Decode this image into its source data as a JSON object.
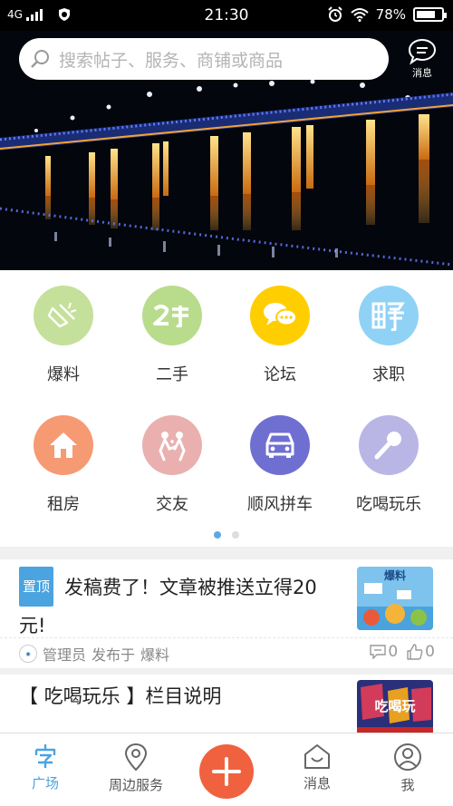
{
  "status_bar": {
    "network": "4G",
    "time": "21:30",
    "battery": "78%",
    "battery_level": 0.78
  },
  "header": {
    "search_placeholder": "搜索帖子、服务、商铺或商品",
    "message_label": "消息"
  },
  "categories": [
    {
      "label": "爆料",
      "color": "#c5e09a",
      "icon": "megaphone-icon"
    },
    {
      "label": "二手",
      "color": "#b8dc8c",
      "icon": "second-hand-icon"
    },
    {
      "label": "论坛",
      "color": "#ffce00",
      "icon": "chat-bubbles-icon"
    },
    {
      "label": "求职",
      "color": "#8fd2f5",
      "icon": "recruit-icon"
    },
    {
      "label": "租房",
      "color": "#f59a73",
      "icon": "house-icon"
    },
    {
      "label": "交友",
      "color": "#eab0b0",
      "icon": "friends-icon"
    },
    {
      "label": "顺风拼车",
      "color": "#6f6fd1",
      "icon": "car-icon"
    },
    {
      "label": "吃喝玩乐",
      "color": "#b9b6e6",
      "icon": "microphone-icon"
    }
  ],
  "pager": {
    "pages": 2,
    "active": 0
  },
  "posts": [
    {
      "tag": "置顶",
      "title": "发稿费了！文章被推送立得20元!",
      "author": "管理员",
      "action": "发布于",
      "board": "爆料",
      "comments": "0",
      "likes": "0",
      "thumb_text": "爆料"
    },
    {
      "title": "【 吃喝玩乐 】栏目说明",
      "thumb_text": "吃喝玩"
    }
  ],
  "tabbar": {
    "items": [
      {
        "label": "广场",
        "icon": "square-icon",
        "active": true
      },
      {
        "label": "周边服务",
        "icon": "location-pin-icon",
        "active": false
      },
      {
        "label": "消息",
        "icon": "message-house-icon",
        "active": false
      },
      {
        "label": "我",
        "icon": "person-icon",
        "active": false
      }
    ],
    "accent": "#4ba3e0",
    "plus_color": "#f0623f"
  }
}
